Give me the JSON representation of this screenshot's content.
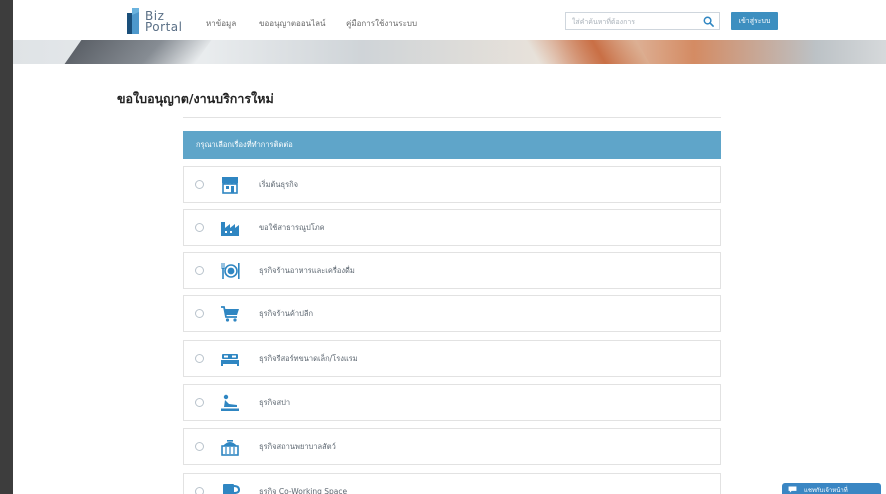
{
  "header": {
    "logo_line1": "Biz",
    "logo_line2": "Portal",
    "nav": [
      "หาข้อมูล",
      "ขออนุญาตออนไลน์",
      "คู่มือการใช้งานระบบ"
    ],
    "search_placeholder": "ใส่คำค้นหาที่ต้องการ",
    "login_label": "เข้าสู่ระบบ"
  },
  "page": {
    "title": "ขอใบอนุญาต/งานบริการใหม่",
    "panel_heading": "กรุณาเลือกเรื่องที่ทำการติดต่อ"
  },
  "options": [
    {
      "label": "เริ่มต้นธุรกิจ",
      "icon": "storefront-icon",
      "selected": false
    },
    {
      "label": "ขอใช้สาธารณูปโภค",
      "icon": "factory-icon",
      "selected": false
    },
    {
      "label": "ธุรกิจร้านอาหารและเครื่องดื่ม",
      "icon": "dining-icon",
      "selected": false
    },
    {
      "label": "ธุรกิจร้านค้าปลีก",
      "icon": "shopping-cart-icon",
      "selected": false
    },
    {
      "label": "ธุรกิจรีสอร์ทขนาดเล็ก/โรงแรม",
      "icon": "bed-icon",
      "selected": false
    },
    {
      "label": "ธุรกิจสปา",
      "icon": "spa-massage-icon",
      "selected": false
    },
    {
      "label": "ธุรกิจสถานพยาบาลสัตว์",
      "icon": "pet-carrier-icon",
      "selected": false
    },
    {
      "label": "ธุรกิจ Co-Working Space",
      "icon": "coffee-cup-icon",
      "selected": false
    }
  ],
  "chat": {
    "label": "แชทกับเจ้าหน้าที่"
  },
  "colors": {
    "accent": "#5fa5c9",
    "button": "#3d8fc0",
    "icon": "#2f86c2",
    "frame": "#3d3d3d"
  }
}
